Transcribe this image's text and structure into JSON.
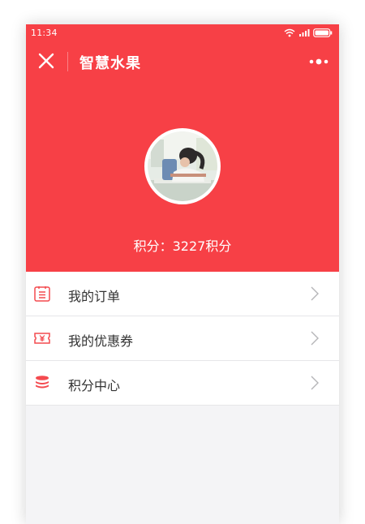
{
  "status": {
    "time": "11:34"
  },
  "nav": {
    "title": "智慧水果",
    "close_icon": "close-icon",
    "more_icon": "more-dots-icon"
  },
  "profile": {
    "points_label": "积分：3227积分",
    "points": 3227
  },
  "menu": {
    "items": [
      {
        "label": "我的订单",
        "icon": "order-list-icon"
      },
      {
        "label": "我的优惠券",
        "icon": "coupon-icon"
      },
      {
        "label": "积分中心",
        "icon": "points-stack-icon"
      }
    ]
  },
  "colors": {
    "brand": "#f74046",
    "icon": "#f44a4f",
    "background": "#f4f4f6"
  }
}
